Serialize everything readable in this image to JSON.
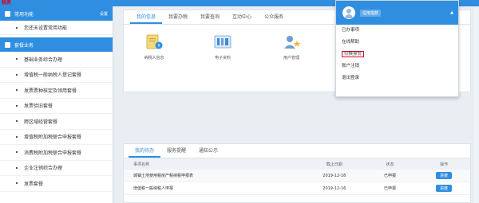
{
  "header": {
    "logo_text": "税务"
  },
  "sidebar": {
    "common_title": "常用功能",
    "common_action": "设置",
    "common_items": [
      {
        "label": "您还未设置常用功能"
      }
    ],
    "package_title": "套餐业务",
    "items": [
      {
        "label": "基础业务综合办理"
      },
      {
        "label": "增值税一般纳税人登记套餐"
      },
      {
        "label": "发票票种核定及领用套餐"
      },
      {
        "label": "发票验旧套餐"
      },
      {
        "label": "跨区域经营套餐"
      },
      {
        "label": "增值税附加税联合申报套餐"
      },
      {
        "label": "消费税附加税联合申报套餐"
      },
      {
        "label": "企业注销综合办理"
      },
      {
        "label": "发票套餐"
      }
    ]
  },
  "main": {
    "tabs": [
      {
        "label": "我的信息"
      },
      {
        "label": "我要办税"
      },
      {
        "label": "我要查询"
      },
      {
        "label": "互动中心"
      },
      {
        "label": "公众服务"
      }
    ],
    "quick": [
      {
        "label": "纳税人信息"
      },
      {
        "label": "电子资料"
      },
      {
        "label": "用户管理"
      }
    ]
  },
  "todo": {
    "tabs": [
      {
        "label": "我的待办"
      },
      {
        "label": "服务提醒"
      },
      {
        "label": "通知公示"
      }
    ],
    "columns": [
      "事项名称",
      "截止日期",
      "状态",
      "操作"
    ],
    "rows": [
      {
        "name": "城镇土地使用税房产税纳税申报表",
        "date": "2019-12-16",
        "status": "已申报",
        "action": "进度"
      },
      {
        "name": "增值税一般纳税人申报",
        "date": "2019-12-16",
        "status": "已申报",
        "action": "进度"
      }
    ]
  },
  "dropdown": {
    "username": "信用指数",
    "items": [
      {
        "label": "已办事项"
      },
      {
        "label": "在线帮助"
      },
      {
        "label": "切换身份"
      },
      {
        "label": "账户注销"
      },
      {
        "label": "退出登录"
      }
    ]
  },
  "colors": {
    "primary": "#2f8ee0",
    "highlight_border": "#e0001a"
  }
}
